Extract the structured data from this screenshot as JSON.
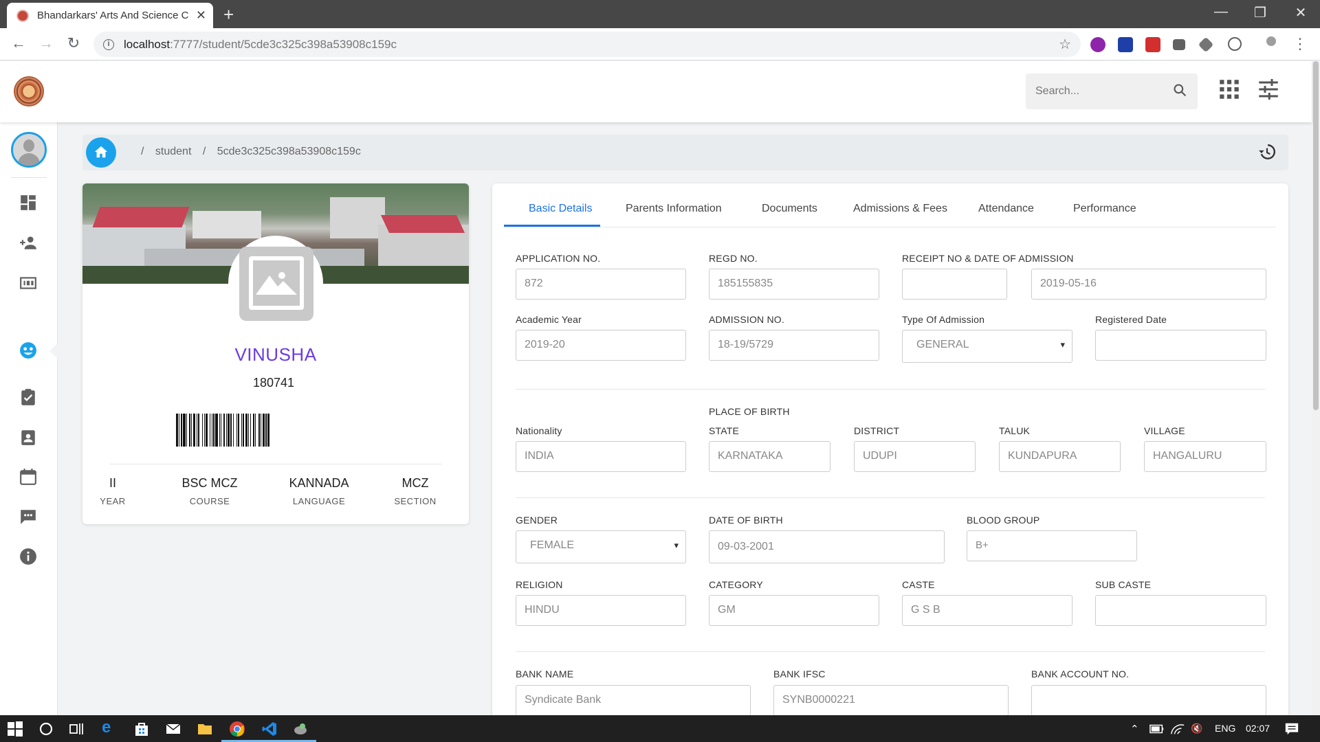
{
  "browser": {
    "tab_title": "Bhandarkars' Arts And Science C",
    "url_host": "localhost",
    "url_path": ":7777/student/5cde3c325c398a53908c159c",
    "new_tab": "+",
    "close_tab": "✕",
    "minimize": "—",
    "restore": "❐",
    "close_window": "✕"
  },
  "header": {
    "search_placeholder": "Search..."
  },
  "breadcrumb": {
    "sep1": "/",
    "item1": "student",
    "sep2": "/",
    "item2": "5cde3c325c398a53908c159c"
  },
  "profile": {
    "name": "VINUSHA",
    "number": "180741",
    "stats": [
      {
        "value": "II",
        "label": "YEAR"
      },
      {
        "value": "BSC MCZ",
        "label": "COURSE"
      },
      {
        "value": "KANNADA",
        "label": "LANGUAGE"
      },
      {
        "value": "MCZ",
        "label": "SECTION"
      }
    ]
  },
  "tabs": [
    "Basic Details",
    "Parents Information",
    "Documents",
    "Admissions & Fees",
    "Attendance",
    "Performance"
  ],
  "fields": {
    "application_no": {
      "label": "APPLICATION NO.",
      "value": "872"
    },
    "regd_no": {
      "label": "REGD NO.",
      "value": "185155835"
    },
    "receipt": {
      "label": "RECEIPT NO & DATE OF ADMISSION",
      "value": "",
      "date": "2019-05-16"
    },
    "academic_year": {
      "label": "Academic Year",
      "value": "2019-20"
    },
    "admission_no": {
      "label": "ADMISSION NO.",
      "value": "18-19/5729"
    },
    "type_of_admission": {
      "label": "Type Of Admission",
      "value": "GENERAL"
    },
    "registered_date": {
      "label": "Registered Date",
      "value": ""
    },
    "place_of_birth": "PLACE OF BIRTH",
    "nationality": {
      "label": "Nationality",
      "value": "INDIA"
    },
    "state": {
      "label": "STATE",
      "value": "KARNATAKA"
    },
    "district": {
      "label": "DISTRICT",
      "value": "UDUPI"
    },
    "taluk": {
      "label": "TALUK",
      "value": "KUNDAPURA"
    },
    "village": {
      "label": "VILLAGE",
      "value": "HANGALURU"
    },
    "gender": {
      "label": "GENDER",
      "value": "FEMALE"
    },
    "dob": {
      "label": "DATE OF BIRTH",
      "value": "09-03-2001"
    },
    "blood_group": {
      "label": "BLOOD GROUP",
      "value": "B+"
    },
    "religion": {
      "label": "RELIGION",
      "value": "HINDU"
    },
    "category": {
      "label": "CATEGORY",
      "value": "GM"
    },
    "caste": {
      "label": "CASTE",
      "value": "G S B"
    },
    "sub_caste": {
      "label": "SUB CASTE",
      "value": ""
    },
    "bank_name": {
      "label": "BANK NAME",
      "value": "Syndicate Bank"
    },
    "bank_ifsc": {
      "label": "BANK IFSC",
      "value": "SYNB0000221"
    },
    "bank_account": {
      "label": "BANK ACCOUNT NO.",
      "value": ""
    }
  },
  "taskbar": {
    "lang": "ENG",
    "time": "02:07"
  },
  "colors": {
    "accent": "#1a73e8",
    "name": "#6a3be4",
    "home": "#1aa3ec"
  }
}
